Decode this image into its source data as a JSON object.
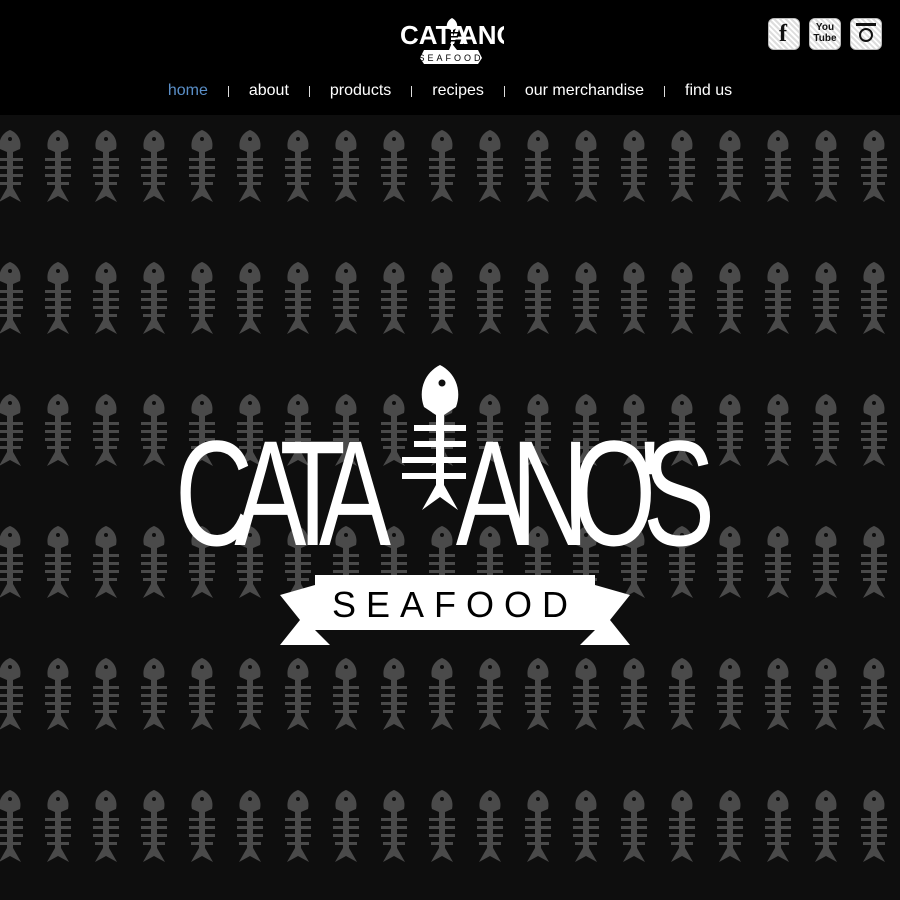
{
  "brand": {
    "name": "CATALANO'S",
    "name_left": "CATA",
    "name_right": "ANO'S",
    "tagline": "SEAFOOD"
  },
  "nav": {
    "items": [
      {
        "label": "home",
        "active": true
      },
      {
        "label": "about",
        "active": false
      },
      {
        "label": "products",
        "active": false
      },
      {
        "label": "recipes",
        "active": false
      },
      {
        "label": "our merchandise",
        "active": false
      },
      {
        "label": "find us",
        "active": false
      }
    ]
  },
  "social": {
    "facebook": {
      "glyph": "f",
      "icon": "facebook-icon"
    },
    "youtube": {
      "line1": "You",
      "line2": "Tube",
      "icon": "youtube-icon"
    },
    "instagram": {
      "icon": "instagram-icon"
    }
  },
  "colors": {
    "background": "#000000",
    "pattern_bg": "#0e0e0e",
    "pattern_fish": "#4a4a4a",
    "active_nav": "#5a8fc8",
    "text": "#ffffff"
  }
}
